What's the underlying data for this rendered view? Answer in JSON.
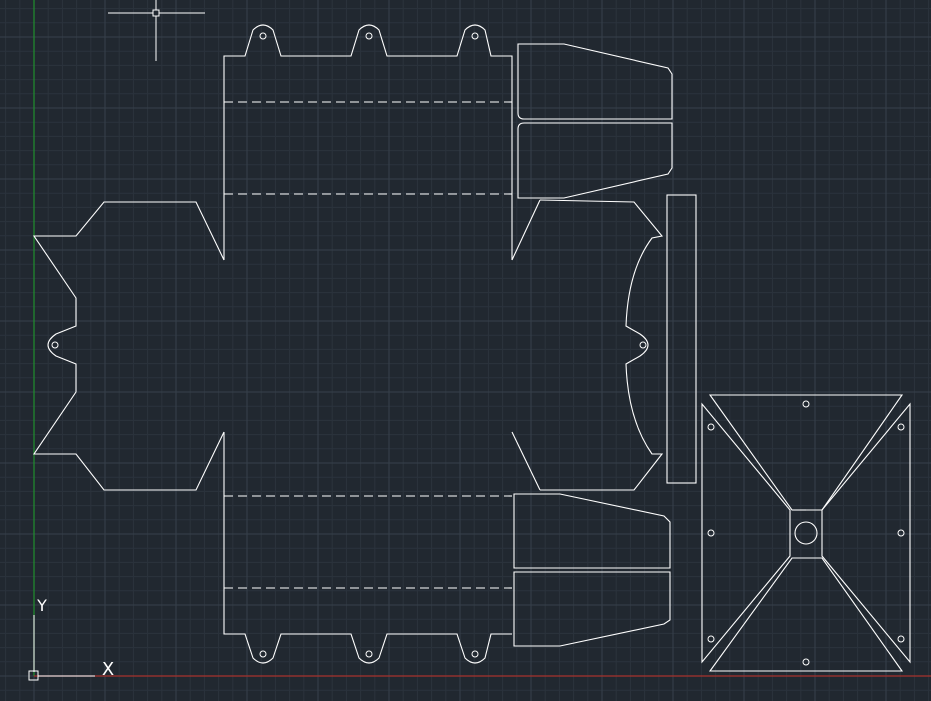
{
  "app": {
    "view_style": "2D Wireframe",
    "drawing_type": "box-net"
  },
  "colors": {
    "background": "#212830",
    "grid_minor": "#2b333d",
    "grid_major": "#36404b",
    "geometry": "#ffffff",
    "y_axis": "#1f8f2e",
    "x_axis": "#a8322c"
  },
  "ucs": {
    "x_label": "X",
    "y_label": "Y"
  },
  "cursor": {
    "type": "crosshair-pickbox"
  }
}
